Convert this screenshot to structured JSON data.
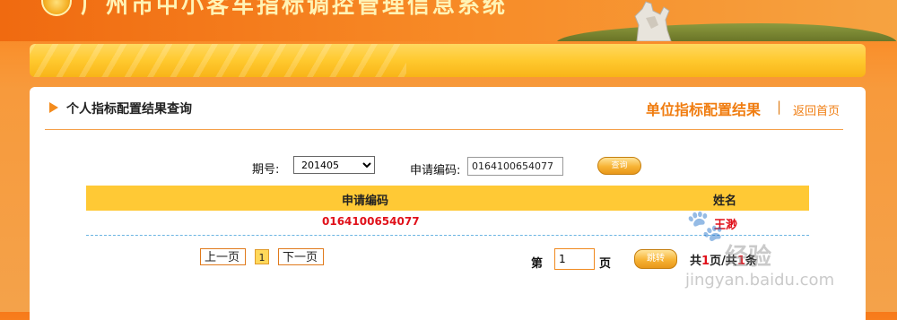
{
  "header": {
    "system_title": "广州市中小客车指标调控管理信息系统"
  },
  "panel": {
    "title": "个人指标配置结果查询",
    "unit_result_link": "单位指标配置结果",
    "separator": "|",
    "home_link": "返回首页"
  },
  "search": {
    "period_label": "期号:",
    "period_value": "201405",
    "code_label": "申请编码:",
    "code_value": "0164100654077",
    "query_button": "查询"
  },
  "table": {
    "columns": [
      "申请编码",
      "姓名"
    ],
    "rows": [
      {
        "code": "0164100654077",
        "name": "王渺"
      }
    ]
  },
  "pager": {
    "prev": "上一页",
    "current": "1",
    "next": "下一页",
    "page_prefix": "第",
    "page_value": "1",
    "page_suffix": "页",
    "jump_button": "跳转",
    "total_pages_prefix": "共",
    "total_pages": "1",
    "total_pages_suffix": "页/共",
    "total_records": "1",
    "total_records_suffix": "条"
  },
  "watermark": {
    "logo_glyph": "🐾",
    "text": "经验",
    "url": "jingyan.baidu.com"
  },
  "colors": {
    "accent": "#f07d11",
    "table_header": "#ffc935",
    "highlight_text": "#e0101a"
  }
}
